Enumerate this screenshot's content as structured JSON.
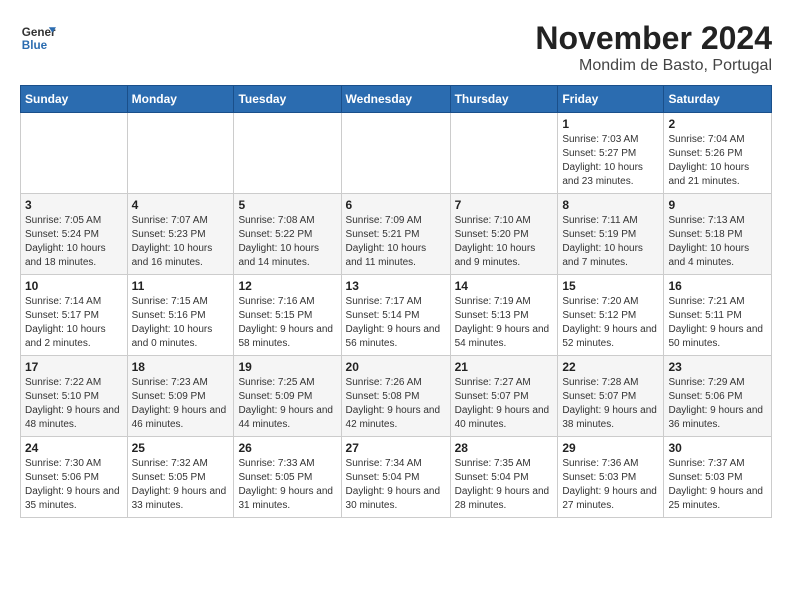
{
  "logo": {
    "line1": "General",
    "line2": "Blue"
  },
  "title": "November 2024",
  "subtitle": "Mondim de Basto, Portugal",
  "weekdays": [
    "Sunday",
    "Monday",
    "Tuesday",
    "Wednesday",
    "Thursday",
    "Friday",
    "Saturday"
  ],
  "weeks": [
    [
      {
        "day": "",
        "info": ""
      },
      {
        "day": "",
        "info": ""
      },
      {
        "day": "",
        "info": ""
      },
      {
        "day": "",
        "info": ""
      },
      {
        "day": "",
        "info": ""
      },
      {
        "day": "1",
        "info": "Sunrise: 7:03 AM\nSunset: 5:27 PM\nDaylight: 10 hours and 23 minutes."
      },
      {
        "day": "2",
        "info": "Sunrise: 7:04 AM\nSunset: 5:26 PM\nDaylight: 10 hours and 21 minutes."
      }
    ],
    [
      {
        "day": "3",
        "info": "Sunrise: 7:05 AM\nSunset: 5:24 PM\nDaylight: 10 hours and 18 minutes."
      },
      {
        "day": "4",
        "info": "Sunrise: 7:07 AM\nSunset: 5:23 PM\nDaylight: 10 hours and 16 minutes."
      },
      {
        "day": "5",
        "info": "Sunrise: 7:08 AM\nSunset: 5:22 PM\nDaylight: 10 hours and 14 minutes."
      },
      {
        "day": "6",
        "info": "Sunrise: 7:09 AM\nSunset: 5:21 PM\nDaylight: 10 hours and 11 minutes."
      },
      {
        "day": "7",
        "info": "Sunrise: 7:10 AM\nSunset: 5:20 PM\nDaylight: 10 hours and 9 minutes."
      },
      {
        "day": "8",
        "info": "Sunrise: 7:11 AM\nSunset: 5:19 PM\nDaylight: 10 hours and 7 minutes."
      },
      {
        "day": "9",
        "info": "Sunrise: 7:13 AM\nSunset: 5:18 PM\nDaylight: 10 hours and 4 minutes."
      }
    ],
    [
      {
        "day": "10",
        "info": "Sunrise: 7:14 AM\nSunset: 5:17 PM\nDaylight: 10 hours and 2 minutes."
      },
      {
        "day": "11",
        "info": "Sunrise: 7:15 AM\nSunset: 5:16 PM\nDaylight: 10 hours and 0 minutes."
      },
      {
        "day": "12",
        "info": "Sunrise: 7:16 AM\nSunset: 5:15 PM\nDaylight: 9 hours and 58 minutes."
      },
      {
        "day": "13",
        "info": "Sunrise: 7:17 AM\nSunset: 5:14 PM\nDaylight: 9 hours and 56 minutes."
      },
      {
        "day": "14",
        "info": "Sunrise: 7:19 AM\nSunset: 5:13 PM\nDaylight: 9 hours and 54 minutes."
      },
      {
        "day": "15",
        "info": "Sunrise: 7:20 AM\nSunset: 5:12 PM\nDaylight: 9 hours and 52 minutes."
      },
      {
        "day": "16",
        "info": "Sunrise: 7:21 AM\nSunset: 5:11 PM\nDaylight: 9 hours and 50 minutes."
      }
    ],
    [
      {
        "day": "17",
        "info": "Sunrise: 7:22 AM\nSunset: 5:10 PM\nDaylight: 9 hours and 48 minutes."
      },
      {
        "day": "18",
        "info": "Sunrise: 7:23 AM\nSunset: 5:09 PM\nDaylight: 9 hours and 46 minutes."
      },
      {
        "day": "19",
        "info": "Sunrise: 7:25 AM\nSunset: 5:09 PM\nDaylight: 9 hours and 44 minutes."
      },
      {
        "day": "20",
        "info": "Sunrise: 7:26 AM\nSunset: 5:08 PM\nDaylight: 9 hours and 42 minutes."
      },
      {
        "day": "21",
        "info": "Sunrise: 7:27 AM\nSunset: 5:07 PM\nDaylight: 9 hours and 40 minutes."
      },
      {
        "day": "22",
        "info": "Sunrise: 7:28 AM\nSunset: 5:07 PM\nDaylight: 9 hours and 38 minutes."
      },
      {
        "day": "23",
        "info": "Sunrise: 7:29 AM\nSunset: 5:06 PM\nDaylight: 9 hours and 36 minutes."
      }
    ],
    [
      {
        "day": "24",
        "info": "Sunrise: 7:30 AM\nSunset: 5:06 PM\nDaylight: 9 hours and 35 minutes."
      },
      {
        "day": "25",
        "info": "Sunrise: 7:32 AM\nSunset: 5:05 PM\nDaylight: 9 hours and 33 minutes."
      },
      {
        "day": "26",
        "info": "Sunrise: 7:33 AM\nSunset: 5:05 PM\nDaylight: 9 hours and 31 minutes."
      },
      {
        "day": "27",
        "info": "Sunrise: 7:34 AM\nSunset: 5:04 PM\nDaylight: 9 hours and 30 minutes."
      },
      {
        "day": "28",
        "info": "Sunrise: 7:35 AM\nSunset: 5:04 PM\nDaylight: 9 hours and 28 minutes."
      },
      {
        "day": "29",
        "info": "Sunrise: 7:36 AM\nSunset: 5:03 PM\nDaylight: 9 hours and 27 minutes."
      },
      {
        "day": "30",
        "info": "Sunrise: 7:37 AM\nSunset: 5:03 PM\nDaylight: 9 hours and 25 minutes."
      }
    ]
  ]
}
